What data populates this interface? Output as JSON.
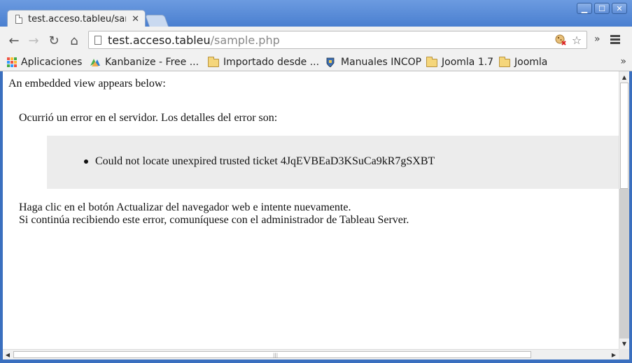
{
  "window": {
    "tab_title": "test.acceso.tableu/sam",
    "tab_close": "✕",
    "buttons": {
      "minimize": "▁",
      "maximize": "☐",
      "close": "✕"
    }
  },
  "toolbar": {
    "back": "←",
    "forward": "→",
    "reload": "↻",
    "home": "⌂",
    "url_host": "test.acceso.tableu",
    "url_path": "/sample.php",
    "star": "☆",
    "extensions_more": "»"
  },
  "bookmarks": {
    "items": [
      {
        "label": "Aplicaciones",
        "icon": "apps-grid-icon"
      },
      {
        "label": "Kanbanize - Free ...",
        "icon": "kanbanize-icon"
      },
      {
        "label": "Importado desde ...",
        "icon": "folder-icon"
      },
      {
        "label": "Manuales INCOP",
        "icon": "incop-icon"
      },
      {
        "label": "Joomla 1.7",
        "icon": "folder-icon"
      },
      {
        "label": "Joomla",
        "icon": "folder-icon"
      }
    ],
    "more": "»"
  },
  "page": {
    "intro": "An embedded view appears below:",
    "error_heading": "Ocurrió un error en el servidor. Los detalles del error son:",
    "error_detail": "Could not locate unexpired trusted ticket 4JqEVBEaD3KSuCa9kR7gSXBT",
    "advice_line1": "Haga clic en el botón Actualizar del navegador web e intente nuevamente.",
    "advice_line2": "Si continúa recibiendo este error, comuníquese con el administrador de Tableau Server."
  },
  "scrollbars": {
    "up": "▲",
    "down": "▼",
    "left": "◀",
    "right": "▶",
    "grip_v": "≡",
    "grip_h": "|||"
  },
  "colors": {
    "titlebar": "#4a7fd0",
    "error_box": "#ececec",
    "toolbar": "#f1f1f1"
  }
}
